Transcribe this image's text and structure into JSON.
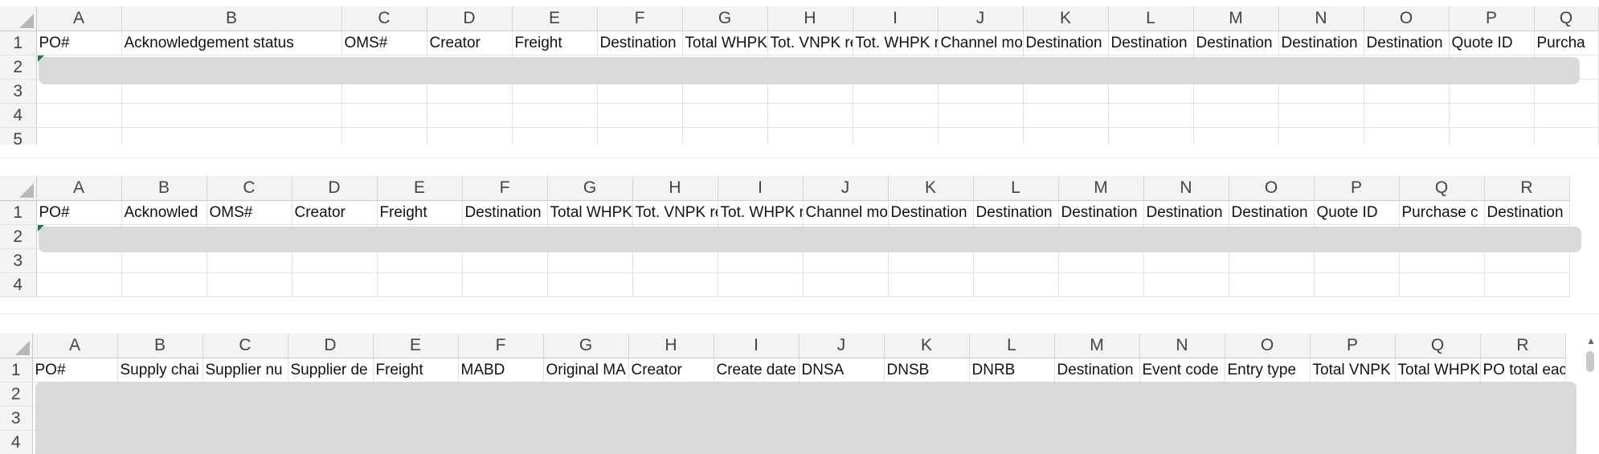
{
  "sheets": [
    {
      "columns": [
        "A",
        "B",
        "C",
        "D",
        "E",
        "F",
        "G",
        "H",
        "I",
        "J",
        "K",
        "L",
        "M",
        "N",
        "O",
        "P",
        "Q"
      ],
      "rows": [
        "1",
        "2",
        "3",
        "4",
        "5"
      ],
      "headers": [
        "PO#",
        "Acknowledgement status",
        "OMS#",
        "Creator",
        "Freight",
        "Destination",
        "Total WHPK",
        "Tot. VNPK re",
        "Tot. WHPK r",
        "Channel mo",
        "Destination",
        "Destination",
        "Destination",
        "Destination",
        "Destination",
        "Quote ID",
        "Purcha"
      ]
    },
    {
      "columns": [
        "A",
        "B",
        "C",
        "D",
        "E",
        "F",
        "G",
        "H",
        "I",
        "J",
        "K",
        "L",
        "M",
        "N",
        "O",
        "P",
        "Q",
        "R"
      ],
      "rows": [
        "1",
        "2",
        "3",
        "4"
      ],
      "headers": [
        "PO#",
        "Acknowled",
        "OMS#",
        "Creator",
        "Freight",
        "Destination",
        "Total WHPK",
        "Tot. VNPK re",
        "Tot. WHPK r",
        "Channel mo",
        "Destination",
        "Destination",
        "Destination",
        "Destination",
        "Destination",
        "Quote ID",
        "Purchase c",
        "Destination"
      ]
    },
    {
      "columns": [
        "A",
        "B",
        "C",
        "D",
        "E",
        "F",
        "G",
        "H",
        "I",
        "J",
        "K",
        "L",
        "M",
        "N",
        "O",
        "P",
        "Q",
        "R"
      ],
      "rows": [
        "1",
        "2",
        "3",
        "4"
      ],
      "headers": [
        "PO#",
        "Supply chai",
        "Supplier nu",
        "Supplier de",
        "Freight",
        "MABD",
        "Original MA",
        "Creator",
        "Create date",
        "DNSA",
        "DNSB",
        "DNRB",
        "Destination",
        "Event code",
        "Entry type",
        "Total VNPK",
        "Total WHPK",
        "PO total eac"
      ]
    }
  ]
}
